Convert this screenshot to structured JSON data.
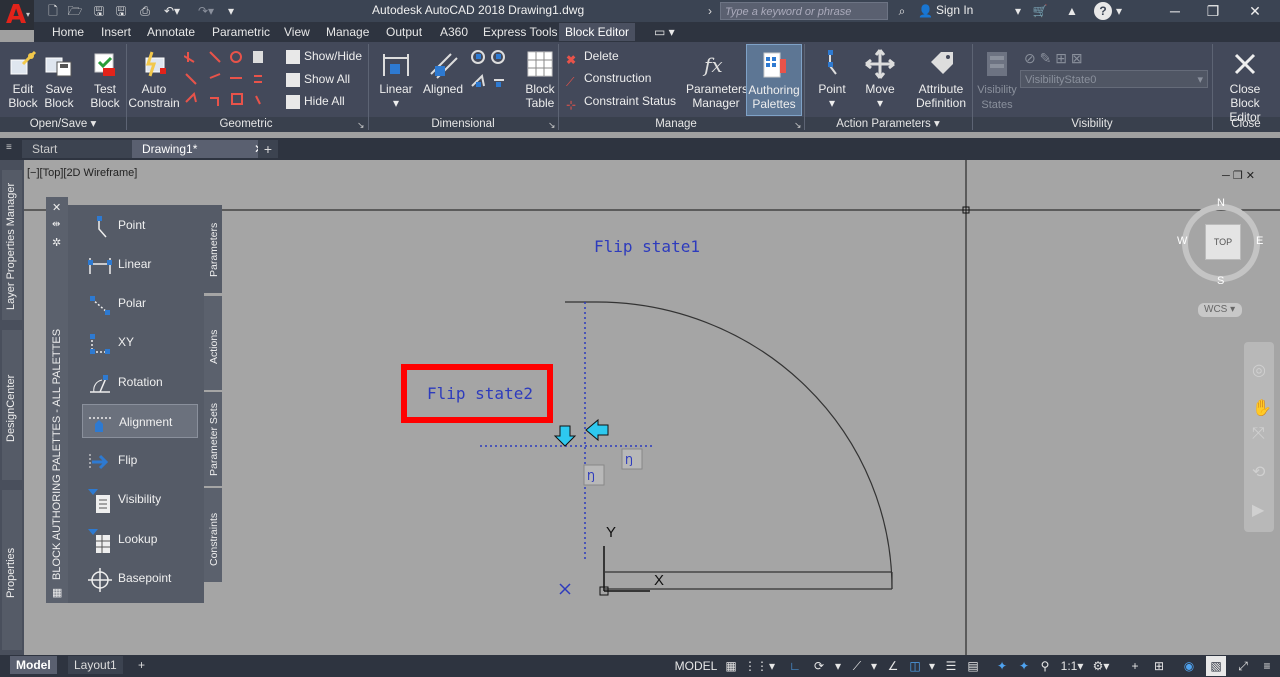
{
  "title_bar": {
    "title": "Autodesk AutoCAD 2018   Drawing1.dwg",
    "search_placeholder": "Type a keyword or phrase",
    "sign_in": "Sign In",
    "help": "?"
  },
  "ribbon_tabs": [
    "Home",
    "Insert",
    "Annotate",
    "Parametric",
    "View",
    "Manage",
    "Output",
    "A360",
    "Express Tools",
    "Block Editor"
  ],
  "active_tab": "Block Editor",
  "ribbon": {
    "openSave": {
      "edit_block": "Edit\nBlock",
      "save_block": "Save\nBlock",
      "panel": "Open/Save"
    },
    "geometric": {
      "test_block": "Test\nBlock",
      "auto_constrain": "Auto\nConstrain",
      "show_hide": "Show/Hide",
      "show_all": "Show All",
      "hide_all": "Hide All",
      "panel": "Geometric"
    },
    "dimensional": {
      "linear": "Linear",
      "aligned": "Aligned",
      "panel": "Dimensional"
    },
    "manage": {
      "block_table": "Block\nTable",
      "delete": "Delete",
      "construction": "Construction",
      "constraint_status": "Constraint Status",
      "parameters_manager": "Parameters\nManager",
      "authoring_palettes": "Authoring\nPalettes",
      "panel": "Manage"
    },
    "action": {
      "point": "Point",
      "move": "Move",
      "attribute_definition": "Attribute\nDefinition",
      "panel": "Action Parameters"
    },
    "visibility": {
      "visibility_states": "Visibility\nStates",
      "state": "VisibilityState0",
      "panel": "Visibility"
    },
    "close": {
      "close_block_editor": "Close\nBlock Editor",
      "panel": "Close"
    }
  },
  "file_tabs": {
    "start": "Start",
    "drawing": "Drawing1*"
  },
  "left_palettes": [
    "Layer Properties Manager",
    "DesignCenter",
    "Properties"
  ],
  "viewport_label": "[−][Top][2D Wireframe]",
  "authoring_palette": {
    "title": "BLOCK AUTHORING PALETTES - ALL PALETTES",
    "items": [
      "Point",
      "Linear",
      "Polar",
      "XY",
      "Rotation",
      "Alignment",
      "Flip",
      "Visibility",
      "Lookup",
      "Basepoint"
    ],
    "selected": "Alignment",
    "tabs": [
      "Parameters",
      "Actions",
      "Parameter Sets",
      "Constraints"
    ]
  },
  "drawing": {
    "flip_state1": "Flip  state1",
    "flip_state2": "Flip  state2",
    "x_axis": "X",
    "y_axis": "Y"
  },
  "viewcube": {
    "n": "N",
    "s": "S",
    "e": "E",
    "w": "W",
    "top": "TOP",
    "wcs": "WCS"
  },
  "status_bar": {
    "model": "Model",
    "layout1": "Layout1",
    "model_btn": "MODEL",
    "scale": "1:1"
  },
  "colors": {
    "accent_red": "#e2231a",
    "blue_text": "#2d3bbd",
    "highlight_box": "#ff0000",
    "grip_cyan": "#2ec9ef"
  }
}
